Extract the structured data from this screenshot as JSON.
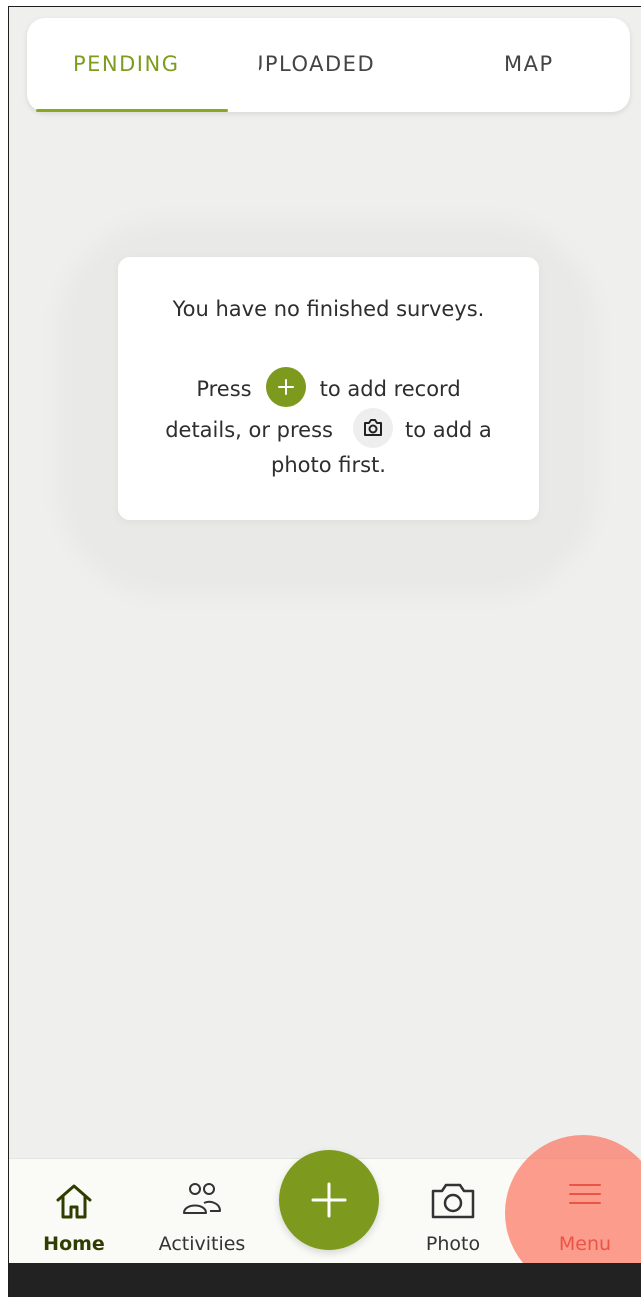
{
  "tabs": [
    {
      "label": "PENDING",
      "active": true
    },
    {
      "label": "UPLOADED",
      "active": false
    },
    {
      "label": "MAP",
      "active": false
    }
  ],
  "empty_state": {
    "line1": "You have no finished surveys.",
    "press": "Press",
    "add_text": "to add record",
    "details_text": "details, or press",
    "photo_text": "to add a",
    "photo_first": "photo first.",
    "add_icon": "plus-icon",
    "camera_icon": "camera-icon"
  },
  "bottom_nav": {
    "home": {
      "label": "Home",
      "icon": "home-icon"
    },
    "activities": {
      "label": "Activities",
      "icon": "people-icon"
    },
    "add": {
      "icon": "plus-icon"
    },
    "photo": {
      "label": "Photo",
      "icon": "camera-icon"
    },
    "menu": {
      "label": "Menu",
      "icon": "hamburger-icon"
    }
  },
  "colors": {
    "accent": "#7e9a1e",
    "tab_active": "#7e9c1f",
    "background": "#eff0ee",
    "menu_highlight": "#fc6e5a",
    "menu_label": "#c01d1a"
  }
}
